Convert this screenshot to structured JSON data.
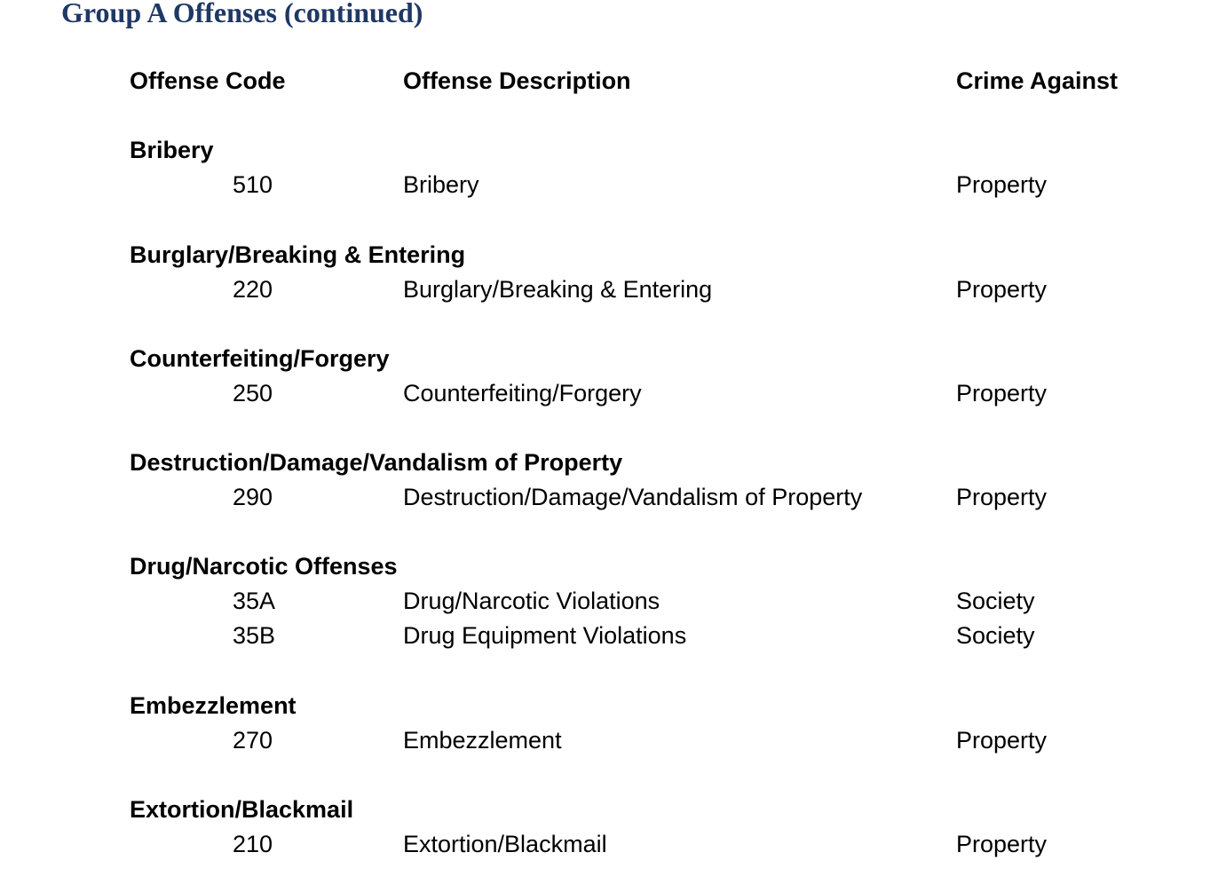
{
  "title": "Group A Offenses (continued)",
  "accent_color": "#1f3864",
  "headers": {
    "code": "Offense Code",
    "description": "Offense Description",
    "against": "Crime Against"
  },
  "groups": [
    {
      "name": "Bribery",
      "offenses": [
        {
          "code": "510",
          "description": "Bribery",
          "against": "Property"
        }
      ]
    },
    {
      "name": "Burglary/Breaking & Entering",
      "offenses": [
        {
          "code": "220",
          "description": "Burglary/Breaking & Entering",
          "against": "Property"
        }
      ]
    },
    {
      "name": "Counterfeiting/Forgery",
      "offenses": [
        {
          "code": "250",
          "description": "Counterfeiting/Forgery",
          "against": "Property"
        }
      ]
    },
    {
      "name": "Destruction/Damage/Vandalism of Property",
      "offenses": [
        {
          "code": "290",
          "description": "Destruction/Damage/Vandalism of Property",
          "against": "Property"
        }
      ]
    },
    {
      "name": "Drug/Narcotic Offenses",
      "offenses": [
        {
          "code": "35A",
          "description": "Drug/Narcotic Violations",
          "against": "Society"
        },
        {
          "code": "35B",
          "description": "Drug Equipment Violations",
          "against": "Society"
        }
      ]
    },
    {
      "name": "Embezzlement",
      "offenses": [
        {
          "code": "270",
          "description": "Embezzlement",
          "against": "Property"
        }
      ]
    },
    {
      "name": "Extortion/Blackmail",
      "offenses": [
        {
          "code": "210",
          "description": "Extortion/Blackmail",
          "against": "Property"
        }
      ]
    }
  ]
}
